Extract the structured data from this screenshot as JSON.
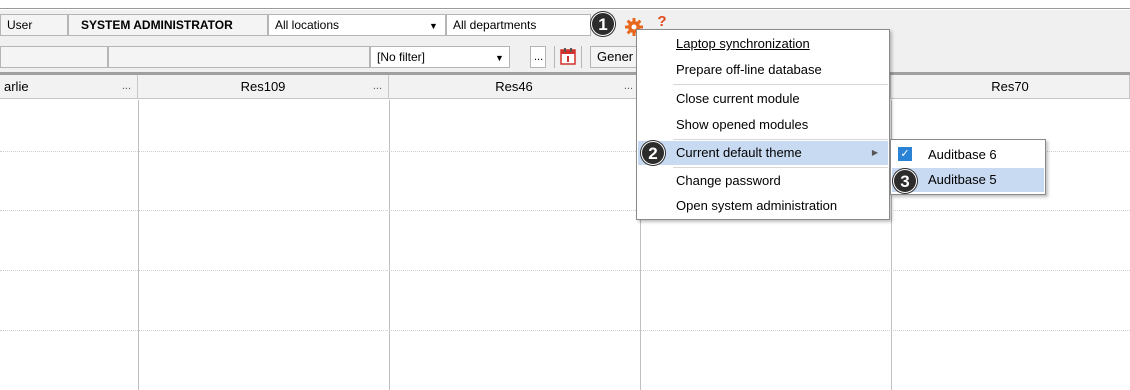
{
  "toolbar": {
    "user_label": "User",
    "user_value": "SYSTEM ADMINISTRATOR",
    "locations": "All locations",
    "departments": "All departments",
    "filter": "[No filter]",
    "ellipsis": "...",
    "general_btn": "Gener"
  },
  "grid": {
    "columns": [
      {
        "label": "arlie"
      },
      {
        "label": "Res109"
      },
      {
        "label": "Res46"
      },
      {
        "label": ""
      },
      {
        "label": "Res70"
      }
    ],
    "ellipsis": "..."
  },
  "badges": [
    "1",
    "2",
    "3"
  ],
  "menu": {
    "items": [
      {
        "label": "Laptop synchronization"
      },
      {
        "label": "Prepare off-line database"
      },
      {
        "label": "Close current module"
      },
      {
        "label": "Show opened modules"
      },
      {
        "label": "Current default theme"
      },
      {
        "label": "Change password"
      },
      {
        "label": "Open system administration"
      }
    ],
    "submenu": [
      {
        "label": "Auditbase 6",
        "checked": true
      },
      {
        "label": "Auditbase 5",
        "checked": false
      }
    ]
  },
  "colors": {
    "gear": "#e8671c",
    "help": "#e04a1f",
    "highlight": "#c7daf1",
    "check": "#2b83d6"
  }
}
